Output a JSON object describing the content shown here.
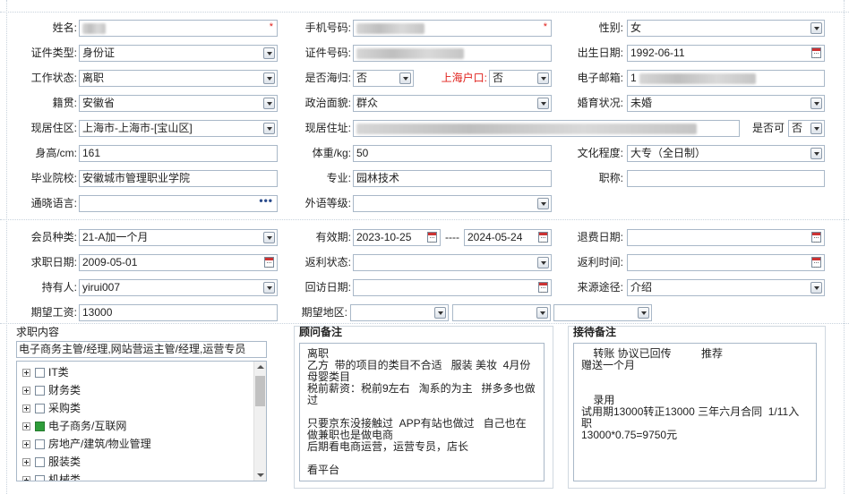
{
  "basic": {
    "name": {
      "label": "姓名:",
      "value": "",
      "required": "*"
    },
    "phone": {
      "label": "手机号码:",
      "value": "",
      "required": "*"
    },
    "gender": {
      "label": "性别:",
      "value": "女"
    },
    "id_type": {
      "label": "证件类型:",
      "value": "身份证"
    },
    "id_number": {
      "label": "证件号码:",
      "value": ""
    },
    "birth_date": {
      "label": "出生日期:",
      "value": "1992-06-11"
    },
    "work_status": {
      "label": "工作状态:",
      "value": "离职"
    },
    "overseas": {
      "label": "是否海归:",
      "value": "否"
    },
    "shanghai_hukou": {
      "label": "上海户口:",
      "value": "否"
    },
    "email": {
      "label": "电子邮箱:",
      "value": "1"
    },
    "native_place": {
      "label": "籍贯:",
      "value": "安徽省"
    },
    "political": {
      "label": "政治面貌:",
      "value": "群众"
    },
    "marital": {
      "label": "婚育状况:",
      "value": "未婚"
    },
    "current_region": {
      "label": "现居住区:",
      "value": "上海市-上海市-[宝山区]"
    },
    "current_address": {
      "label": "现居住址:",
      "value": ""
    },
    "can_accept": {
      "label": "是否可",
      "value": "否"
    },
    "height": {
      "label": "身高/cm:",
      "value": "161"
    },
    "weight": {
      "label": "体重/kg:",
      "value": "50"
    },
    "education": {
      "label": "文化程度:",
      "value": "大专（全日制）"
    },
    "school": {
      "label": "毕业院校:",
      "value": "安徽城市管理职业学院"
    },
    "major": {
      "label": "专业:",
      "value": "园林技术"
    },
    "title": {
      "label": "职称:",
      "value": ""
    },
    "language": {
      "label": "通晓语言:",
      "value": "",
      "more": "•••"
    },
    "foreign_level": {
      "label": "外语等级:",
      "value": ""
    }
  },
  "membership": {
    "member_type": {
      "label": "会员种类:",
      "value": "21-A加一个月"
    },
    "validity": {
      "label": "有效期:",
      "start": "2023-10-25",
      "sep": "----",
      "end": "2024-05-24"
    },
    "refund_date": {
      "label": "退费日期:",
      "value": ""
    },
    "job_seek_date": {
      "label": "求职日期:",
      "value": "2009-05-01"
    },
    "rebate_status": {
      "label": "返利状态:",
      "value": ""
    },
    "rebate_time": {
      "label": "返利时间:",
      "value": ""
    },
    "holder": {
      "label": "持有人:",
      "value": "yirui007"
    },
    "visit_date": {
      "label": "回访日期:",
      "value": ""
    },
    "source": {
      "label": "来源途径:",
      "value": "介绍"
    },
    "expected_salary": {
      "label": "期望工资:",
      "value": "13000"
    },
    "expected_region": {
      "label": "期望地区:",
      "v1": "",
      "v2": "",
      "v3": ""
    }
  },
  "job_content": {
    "title": "求职内容",
    "summary": "电子商务主管/经理,网站营运主管/经理,运营专员",
    "tree": [
      {
        "label": "IT类",
        "checked": false
      },
      {
        "label": "财务类",
        "checked": false
      },
      {
        "label": "采购类",
        "checked": false
      },
      {
        "label": "电子商务/互联网",
        "checked": true
      },
      {
        "label": "房地产/建筑/物业管理",
        "checked": false
      },
      {
        "label": "服装类",
        "checked": false
      },
      {
        "label": "机械类",
        "checked": false
      }
    ]
  },
  "consultant_notes": {
    "title": "顾问备注",
    "text": "离职\n乙方  带的项目的类目不合适   服装 美妆  4月份母婴类目\n税前薪资：税前9左右   淘系的为主   拼多多也做过\n\n只要京东没接触过  APP有站也做过   自己也在做兼职也是做电商\n后期看电商运营，运营专员，店长\n\n看平台"
  },
  "reception_notes": {
    "title": "接待备注",
    "text": "    转账 协议已回传          推荐\n赠送一个月\n\n\n    录用\n试用期13000转正13000 三年六月合同  1/11入职\n13000*0.75=9750元"
  }
}
